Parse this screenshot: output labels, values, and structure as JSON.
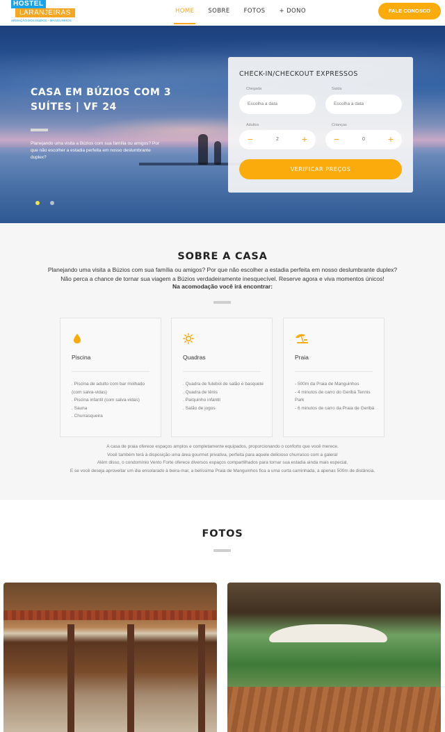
{
  "header": {
    "logo": {
      "top": "HOSTEL",
      "main": "LARANJEIRAS",
      "sub": "ARMAÇÃO DOS BÚZIOS - MANGUINHOS"
    },
    "nav": [
      {
        "label": "HOME",
        "active": true
      },
      {
        "label": "SOBRE",
        "active": false
      },
      {
        "label": "FOTOS",
        "active": false
      },
      {
        "label": "+ DONO",
        "active": false
      }
    ],
    "cta_label": "FALE CONOSCO"
  },
  "hero": {
    "title": "CASA EM BÚZIOS COM 3 SUÍTES | VF 24",
    "text": "Planejando uma visita a Búzios com sua família ou amigos? Por que não escolher a estadia perfeita em nosso deslumbrante duplex?",
    "slides": 2,
    "active_slide": 1
  },
  "booking": {
    "title": "CHECK-IN/CHECKOUT EXPRESSOS",
    "checkin_label": "Chegada",
    "checkin_value": "Escolha a data",
    "checkout_label": "Saída",
    "checkout_value": "Escolha a data",
    "adults_label": "Adultos",
    "adults_value": "2",
    "children_label": "Crianças",
    "children_value": "0",
    "minus": "−",
    "plus": "+",
    "button": "VERIFICAR PREÇOS"
  },
  "sobre": {
    "title": "SOBRE A CASA",
    "intro_1": "Planejando uma visita a Búzios com sua família ou amigos? Por que não escolher a estadia perfeita em nosso deslumbrante duplex?",
    "intro_2": "Não perca a chance de tornar sua viagem a Búzios verdadeiramente inesquecível. Reserve agora e viva momentos únicos!",
    "intro_strong": "Na acomodação você irá encontrar:",
    "cards": [
      {
        "icon": "drop-icon",
        "title": "Piscina",
        "items": [
          ". Piscina de adulto com bar molhado (com salva-vidas)",
          ". Piscina infantil (com salva-vidas)",
          ". Sauna",
          ". Churrasqueira"
        ]
      },
      {
        "icon": "sun-icon",
        "title": "Quadras",
        "items": [
          ". Quadra de futebol de salão e basquete",
          ". Quadra de tênis",
          ". Parquinho infantil",
          ". Salão de jogos"
        ]
      },
      {
        "icon": "beach-umbrella-icon",
        "title": "Praia",
        "items": [
          "- 500m da Praia de Manguinhos",
          "- 4 minutos de carro do Geribá Tennis Park",
          "- 6 minutos de carro da Praia de Geribá"
        ]
      }
    ],
    "para": [
      "A casa de praia oferece espaços amplos e completamente equipados, proporcionando o conforto que você merece.",
      "Você também terá à disposição uma área gourmet privativa, perfeita para aquele delicioso churrasco com a galera!",
      "Além disso, o condomínio Vento Forte oferece diversos espaços compartilhados para tornar sua estadia ainda mais especial.",
      "E se você deseja aproveitar um dia ensolarado à beira-mar, a belíssima Praia de Manguinhos fica a uma curta caminhada, a apenas 500m de distância."
    ]
  },
  "fotos": {
    "title": "FOTOS"
  },
  "colors": {
    "accent": "#fbab0c",
    "brand_blue": "#1aa3e8"
  }
}
